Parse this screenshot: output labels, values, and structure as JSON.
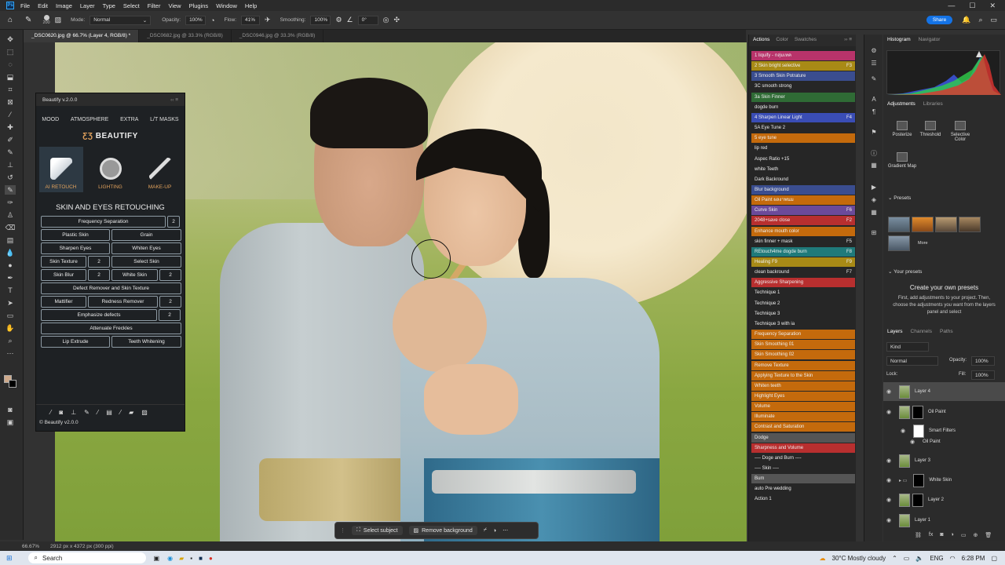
{
  "menubar": {
    "items": [
      "File",
      "Edit",
      "Image",
      "Layer",
      "Type",
      "Select",
      "Filter",
      "View",
      "Plugins",
      "Window",
      "Help"
    ]
  },
  "options": {
    "brush_size": "200",
    "mode_label": "Mode:",
    "mode_value": "Normal",
    "opacity_label": "Opacity:",
    "opacity_value": "100%",
    "flow_label": "Flow:",
    "flow_value": "41%",
    "smoothing_label": "Smoothing:",
    "smoothing_value": "100%",
    "angle_value": "0°",
    "share_label": "Share"
  },
  "tabs": [
    "_DSC0620.jpg @ 66.7% (Layer 4, RGB/8) *",
    "_DSC0682.jpg @ 33.3% (RGB/8)",
    "_DSC0946.jpg @ 33.3% (RGB/8)"
  ],
  "context_bar": {
    "select_subject": "Select subject",
    "remove_background": "Remove background"
  },
  "beautify": {
    "title": "Beautify v.2.0.0",
    "menu": [
      "MOOD",
      "ATMOSPHERE",
      "EXTRA",
      "L/T MASKS"
    ],
    "logo": "BEAUTIFY",
    "modes": [
      "AI RETOUCH",
      "LIGHTING",
      "MAKE-UP"
    ],
    "section": "SKIN AND EYES RETOUCHING",
    "buttons": {
      "freq_sep": "Frequency Separation",
      "freq_sep_n": "2",
      "plastic": "Plastic Skin",
      "grain": "Grain",
      "sharpen_eyes": "Sharpen Eyes",
      "whiten_eyes": "Whiten Eyes",
      "skin_texture": "Skin Texture",
      "skin_texture_n": "2",
      "select_skin": "Select Skin",
      "skin_blur": "Skin Blur",
      "skin_blur_n": "2",
      "white_skin": "White Skin",
      "white_skin_n": "2",
      "defect": "Defect Remover and Skin Texture",
      "mattifier": "Mattifier",
      "redness": "Redness Remover",
      "redness_n": "2",
      "emphasize": "Emphasize defects",
      "emphasize_n": "2",
      "freckles": "Attenuate Freckles",
      "lip": "Lip Extrude",
      "teeth": "Teeth Whitening"
    },
    "version": "© Beautify v2.0.0"
  },
  "actions_panel": {
    "tabs": [
      "Actions",
      "Color",
      "Swatches"
    ],
    "items": [
      {
        "label": "1 liquify - กลุ่มเทค",
        "key": "",
        "color": "#b8336a"
      },
      {
        "label": "2 Skin bright selective",
        "key": "F3",
        "color": "#a88a16"
      },
      {
        "label": "3 Smooth Skin Potrature",
        "key": "",
        "color": "#3a4d8f"
      },
      {
        "label": "3C smooth strong",
        "key": "",
        "color": ""
      },
      {
        "label": "3a Skin Finner",
        "key": "",
        "color": "#2f6b35"
      },
      {
        "label": "dogde burn",
        "key": "",
        "color": ""
      },
      {
        "label": "4 Sharpen Linear Light",
        "key": "F4",
        "color": "#3a4db5"
      },
      {
        "label": "5A Eye Tune 2",
        "key": "",
        "color": ""
      },
      {
        "label": "5 eye tune",
        "key": "",
        "color": "#c46a0c"
      },
      {
        "label": "lip red",
        "key": "",
        "color": ""
      },
      {
        "label": "Aspec Ratio +15",
        "key": "",
        "color": ""
      },
      {
        "label": "white Teeth",
        "key": "",
        "color": ""
      },
      {
        "label": "Dark Backround",
        "key": "",
        "color": ""
      },
      {
        "label": "Blur background",
        "key": "",
        "color": "#3a4d8f"
      },
      {
        "label": "Oil Paint ผลงาพนม",
        "key": "",
        "color": "#c46a0c"
      },
      {
        "label": "Curve Skin",
        "key": "F6",
        "color": "#6b4a9a"
      },
      {
        "label": "2048+save close",
        "key": "F2",
        "color": "#b82f2f"
      },
      {
        "label": "Enhance mouth color",
        "key": "",
        "color": "#c46a0c"
      },
      {
        "label": "skin finner + mask",
        "key": "F5",
        "color": ""
      },
      {
        "label": "REtouch4me dogde burn",
        "key": "F8",
        "color": "#1f7a7a"
      },
      {
        "label": "Healing F9",
        "key": "F9",
        "color": "#a88a16"
      },
      {
        "label": "clean backround",
        "key": "F7",
        "color": ""
      },
      {
        "label": "Aggressive Sharpening",
        "key": "",
        "color": "#b82f2f"
      },
      {
        "label": "Technique 1",
        "key": "",
        "color": ""
      },
      {
        "label": "Technique 2",
        "key": "",
        "color": ""
      },
      {
        "label": "Technique 3",
        "key": "",
        "color": ""
      },
      {
        "label": "Technique 3 with ia",
        "key": "",
        "color": ""
      },
      {
        "label": "Frequency Separation",
        "key": "",
        "color": "#c46a0c"
      },
      {
        "label": "Skin Smoothing 01",
        "key": "",
        "color": "#c46a0c"
      },
      {
        "label": "Skin Smoothing 02",
        "key": "",
        "color": "#c46a0c"
      },
      {
        "label": "Remove Texture",
        "key": "",
        "color": "#c46a0c"
      },
      {
        "label": "Applying Texture to the Skin",
        "key": "",
        "color": "#c46a0c"
      },
      {
        "label": "Whiten teeth",
        "key": "",
        "color": "#c46a0c"
      },
      {
        "label": "Highlight Eyes",
        "key": "",
        "color": "#c46a0c"
      },
      {
        "label": "Volume",
        "key": "",
        "color": "#c46a0c"
      },
      {
        "label": "Illuminate",
        "key": "",
        "color": "#c46a0c"
      },
      {
        "label": "Contrast and Saturation",
        "key": "",
        "color": "#c46a0c"
      },
      {
        "label": "Dodge",
        "key": "",
        "color": "#555555"
      },
      {
        "label": "Sharpness and Volume",
        "key": "",
        "color": "#b82f2f"
      },
      {
        "label": "---- Doge and Burn ----",
        "key": "",
        "color": ""
      },
      {
        "label": "---- Skin ----",
        "key": "",
        "color": ""
      },
      {
        "label": "Bum",
        "key": "",
        "color": "#555555"
      },
      {
        "label": "auto Pre wedding",
        "key": "",
        "color": ""
      },
      {
        "label": "Action 1",
        "key": "",
        "color": ""
      }
    ]
  },
  "right_panel": {
    "tabs1": [
      "Histogram",
      "Navigator"
    ],
    "tabs2": [
      "Adjustments",
      "Libraries"
    ],
    "adjustments": [
      "Posterize",
      "Threshold",
      "Selective Color",
      "Gradient Map"
    ],
    "presets_title": "Presets",
    "more": "More",
    "your_presets": "Your presets",
    "create_title": "Create your own presets",
    "create_desc": "First, add adjustments to your project. Then, choose the adjustments you want from the layers panel and select",
    "tabs3": [
      "Layers",
      "Channels",
      "Paths"
    ],
    "kind": "Kind",
    "blend": "Normal",
    "opacity_label": "Opacity:",
    "opacity": "100%",
    "lock_label": "Lock:",
    "fill_label": "Fill:",
    "fill": "100%",
    "layers": [
      "Layer 4",
      "Oil Paint",
      "Smart Filters",
      "Oil Paint",
      "Layer 3",
      "White Skin",
      "Layer 2",
      "Layer 1"
    ]
  },
  "status": {
    "zoom": "66.67%",
    "size": "2912 px x 4372 px (300 ppi)"
  },
  "taskbar": {
    "search": "Search",
    "weather": "30°C  Mostly cloudy",
    "lang": "ENG",
    "time": "6:28 PM"
  }
}
